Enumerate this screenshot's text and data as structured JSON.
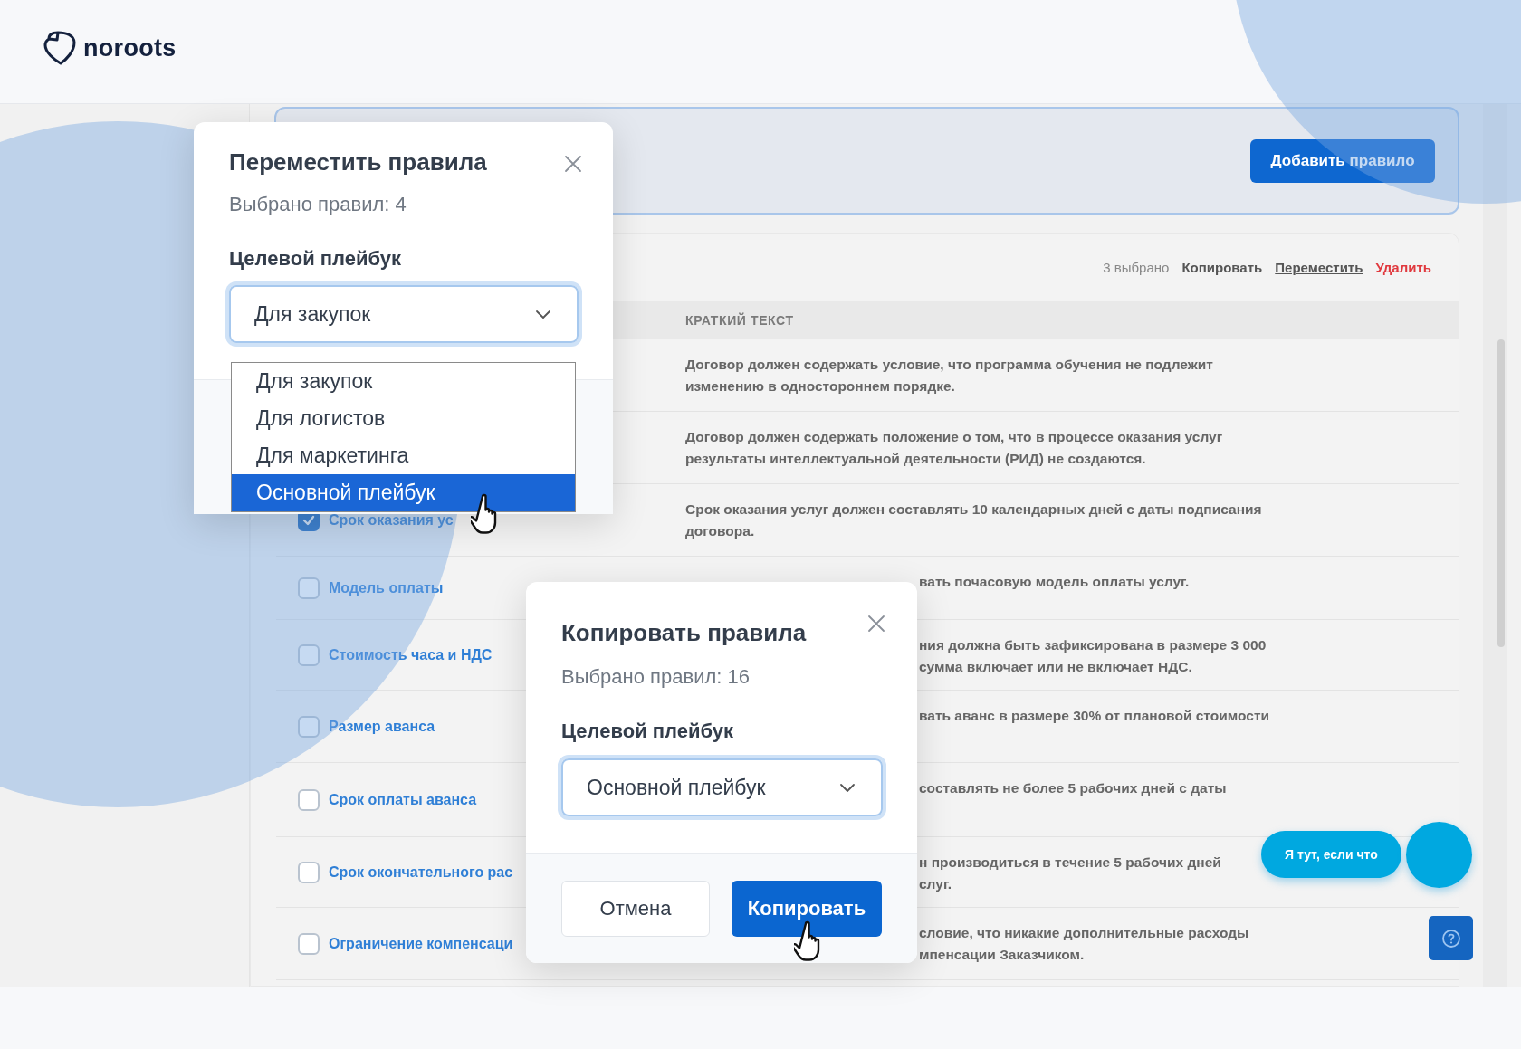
{
  "header": {
    "logo": "noroots"
  },
  "top_panel": {
    "button": "Добавить правило"
  },
  "table": {
    "selection": {
      "count": "3 выбрано",
      "actions": [
        {
          "label": "Копировать",
          "kind": "plain"
        },
        {
          "label": "Переместить",
          "kind": "link"
        },
        {
          "label": "Удалить",
          "kind": "danger"
        }
      ]
    },
    "columns": [
      "КРАТКИЙ ТЕКСТ"
    ],
    "rows": [
      {
        "short_text": "Договор должен содержать условие, что программа обучения не подлежит\nизменению в одностороннем порядке."
      },
      {
        "short_text": "Договор должен содержать положение о том, что в процессе оказания услуг\nрезультаты интеллектуальной деятельности (РИД) не создаются."
      },
      {
        "checked": true,
        "name": "Срок оказания ус",
        "short_text": "Срок оказания услуг должен составлять 10 календарных дней с даты подписания\nдоговора."
      },
      {
        "checked": false,
        "name": "Модель оплаты",
        "short_text": "вать почасовую модель оплаты услуг."
      },
      {
        "checked": false,
        "name": "Стоимость часа и НДС",
        "short_text": "ния должна быть зафиксирована в размере 3 000\nсумма включает или не включает НДС."
      },
      {
        "checked": false,
        "name": "Размер аванса",
        "short_text": "вать аванс в размере 30% от плановой стоимости"
      },
      {
        "checked": false,
        "name": "Срок оплаты аванса",
        "short_text": "составлять не более 5 рабочих дней с даты"
      },
      {
        "checked": false,
        "name": "Срок окончательного рас",
        "short_text": "н производиться в течение 5 рабочих дней\nслуг."
      },
      {
        "checked": false,
        "name": "Ограничение компенсаци",
        "short_text": "словие, что никакие дополнительные расходы\nмпенсации Заказчиком."
      }
    ]
  },
  "chat": {
    "bubble": "Я тут, если что"
  },
  "move_dialog": {
    "title": "Переместить правила",
    "subtitle": "Выбрано правил: 4",
    "field_label": "Целевой плейбук",
    "value": "Для закупок",
    "options": [
      {
        "label": "Для закупок",
        "highlighted": false
      },
      {
        "label": "Для логистов",
        "highlighted": false
      },
      {
        "label": "Для маркетинга",
        "highlighted": false
      },
      {
        "label": "Основной плейбук",
        "highlighted": true
      }
    ]
  },
  "copy_dialog": {
    "title": "Копировать правила",
    "subtitle": "Выбрано правил: 16",
    "field_label": "Целевой плейбук",
    "value": "Основной плейбук",
    "buttons": [
      {
        "label": "Отмена",
        "kind": "secondary"
      },
      {
        "label": "Копировать",
        "kind": "primary"
      }
    ]
  }
}
